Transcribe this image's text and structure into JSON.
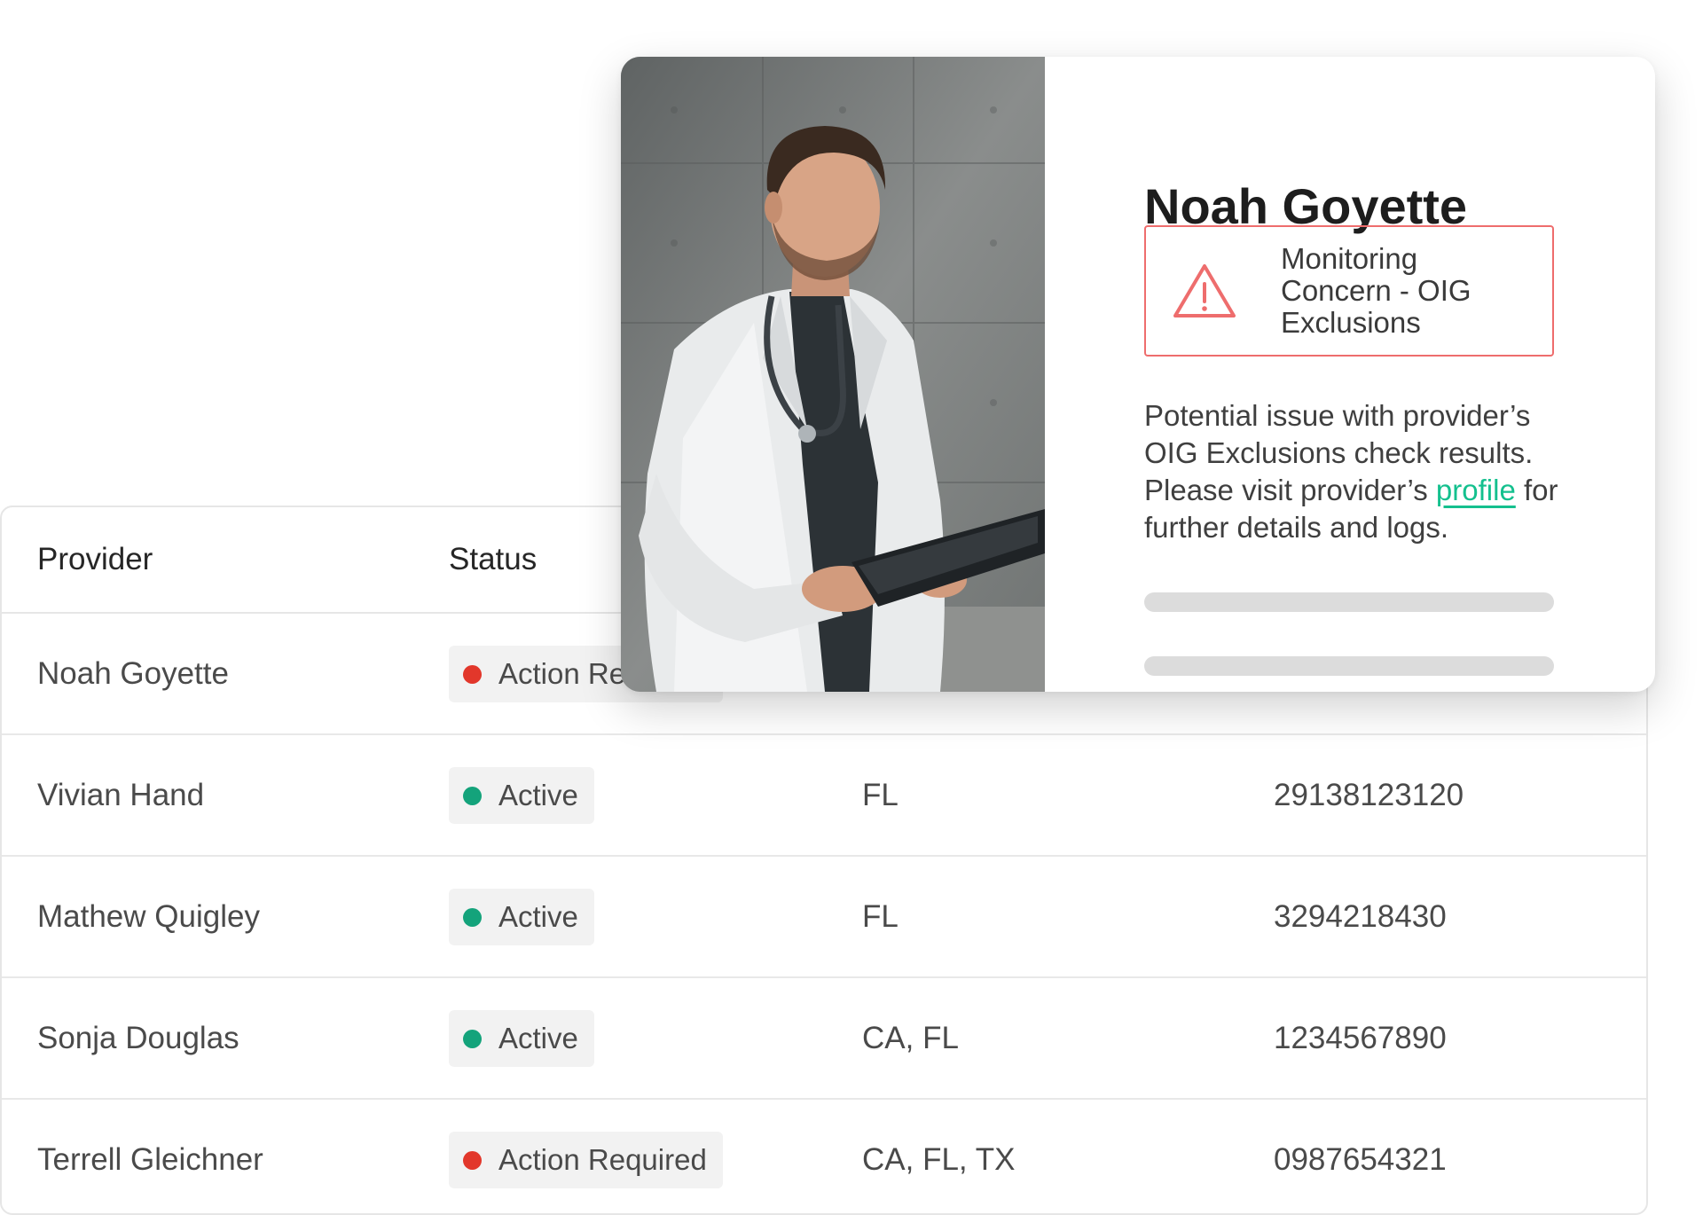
{
  "table": {
    "headers": {
      "provider": "Provider",
      "status": "Status"
    },
    "rows": [
      {
        "provider": "Noah Goyette",
        "status": "Action Required",
        "status_color": "#e2372b",
        "states": "",
        "npi": ""
      },
      {
        "provider": "Vivian Hand",
        "status": "Active",
        "status_color": "#14a37b",
        "states": "FL",
        "npi": "29138123120"
      },
      {
        "provider": "Mathew Quigley",
        "status": "Active",
        "status_color": "#14a37b",
        "states": "FL",
        "npi": "3294218430"
      },
      {
        "provider": "Sonja Douglas",
        "status": "Active",
        "status_color": "#14a37b",
        "states": "CA, FL",
        "npi": "1234567890"
      },
      {
        "provider": "Terrell Gleichner",
        "status": "Action Required",
        "status_color": "#e2372b",
        "states": "CA, FL, TX",
        "npi": "0987654321"
      }
    ]
  },
  "card": {
    "name": "Noah Goyette",
    "alert": {
      "icon": "warning-triangle-icon",
      "text": "Monitoring Concern - OIG Exclusions",
      "color": "#ee6d6d"
    },
    "description": {
      "before_link": "Potential issue with provider’s OIG Exclusions check results. Please visit provider’s ",
      "link": "profile",
      "after_link": " for further details and logs."
    },
    "link_color": "#14c08e"
  }
}
